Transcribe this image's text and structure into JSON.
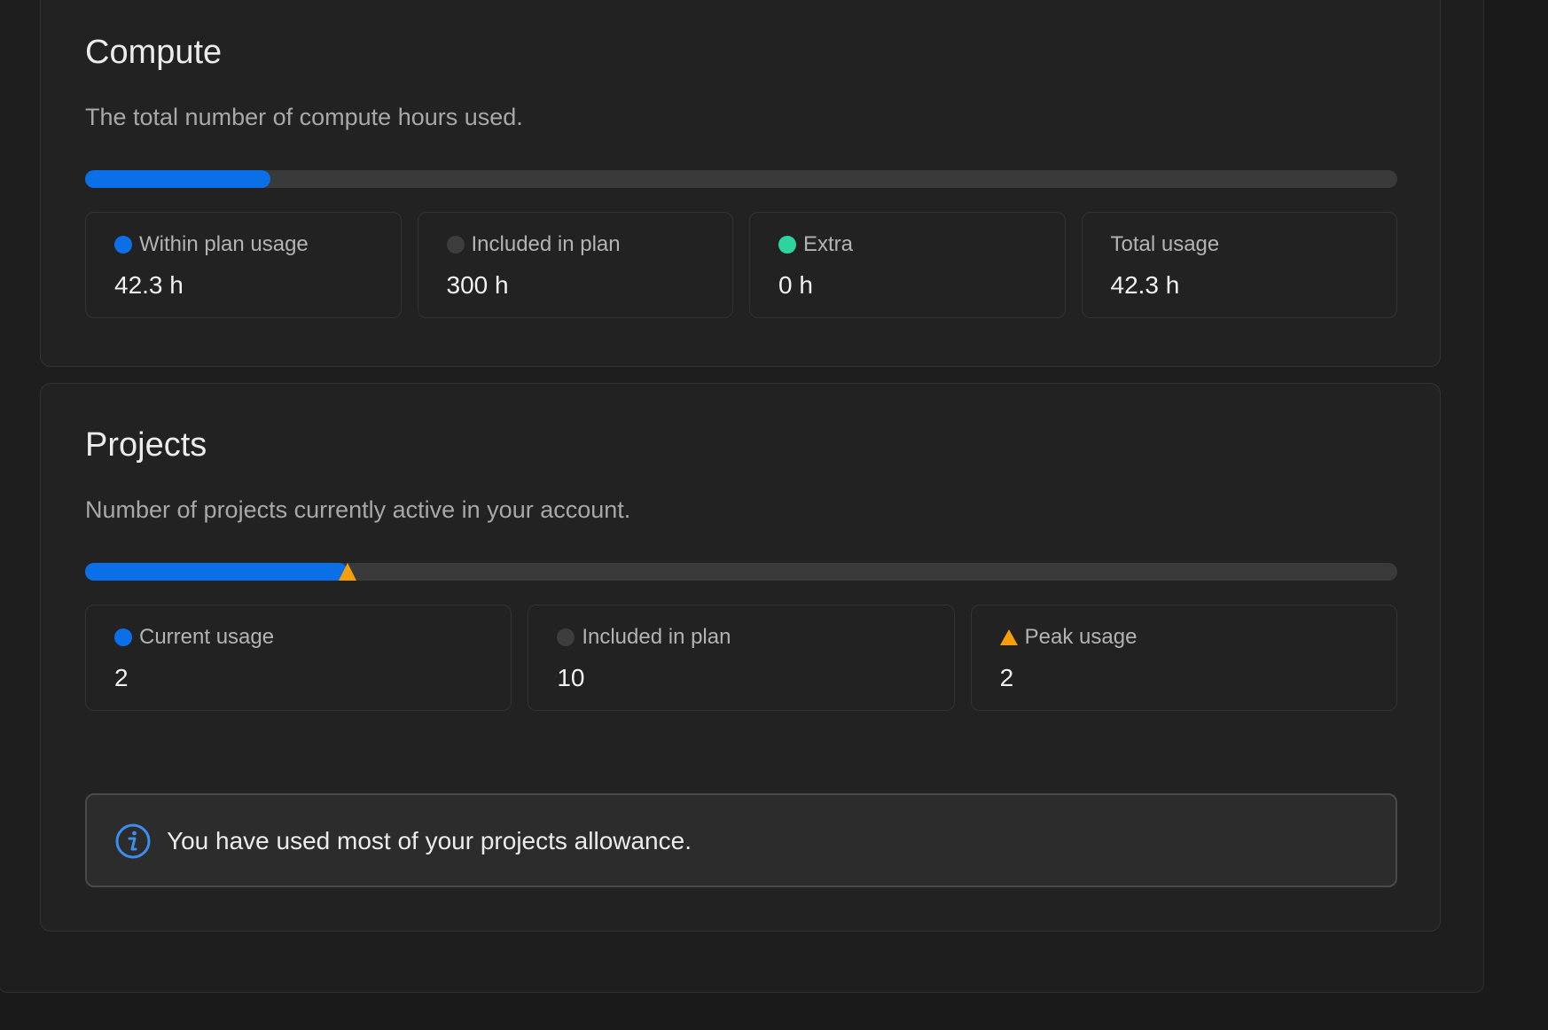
{
  "compute": {
    "title": "Compute",
    "description": "The total number of compute hours used.",
    "progress_fraction": 0.141,
    "stats": [
      {
        "label": "Within plan usage",
        "value": "42.3 h",
        "indicator": "dot",
        "color": "#0b6fe8"
      },
      {
        "label": "Included in plan",
        "value": "300 h",
        "indicator": "dot",
        "color": "#3d3d3d"
      },
      {
        "label": "Extra",
        "value": "0 h",
        "indicator": "dot",
        "color": "#2dd4a0"
      },
      {
        "label": "Total usage",
        "value": "42.3 h",
        "indicator": "none",
        "color": ""
      }
    ]
  },
  "projects": {
    "title": "Projects",
    "description": "Number of projects currently active in your account.",
    "progress_fraction": 0.2,
    "peak_fraction": 0.2,
    "stats": [
      {
        "label": "Current usage",
        "value": "2",
        "indicator": "dot",
        "color": "#0b6fe8"
      },
      {
        "label": "Included in plan",
        "value": "10",
        "indicator": "dot",
        "color": "#3d3d3d"
      },
      {
        "label": "Peak usage",
        "value": "2",
        "indicator": "triangle",
        "color": "#f59f0b"
      }
    ],
    "notice": {
      "icon": "info-icon",
      "text": "You have used most of your projects allowance."
    }
  },
  "colors": {
    "accent": "#0b6fe8",
    "extra": "#2dd4a0",
    "peak": "#f59f0b",
    "info": "#3b8ef0"
  }
}
